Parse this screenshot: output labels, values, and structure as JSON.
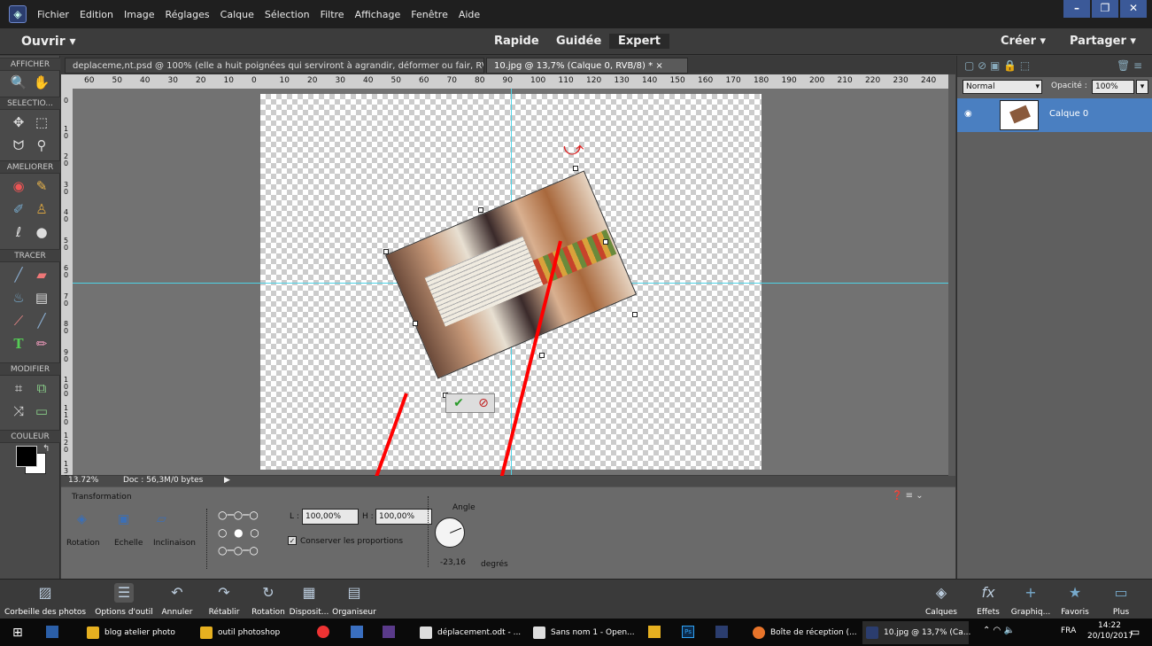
{
  "menubar": {
    "items": [
      "Fichier",
      "Edition",
      "Image",
      "Réglages",
      "Calque",
      "Sélection",
      "Filtre",
      "Affichage",
      "Fenêtre",
      "Aide"
    ]
  },
  "modebar": {
    "open_label": "Ouvrir",
    "modes": [
      "Rapide",
      "Guidée",
      "Expert"
    ],
    "active_mode": "Expert",
    "create_label": "Créer",
    "share_label": "Partager"
  },
  "toolbox": {
    "sections": [
      "AFFICHER",
      "SELECTIO...",
      "AMELIORER",
      "TRACER",
      "MODIFIER",
      "COULEUR"
    ]
  },
  "tabs": [
    {
      "label": "deplaceme,nt.psd @ 100% (elle a huit poignées qui serviront à agrandir, déformer ou fair, RVB/8) *",
      "close": "×"
    },
    {
      "label": "10.jpg @ 13,7% (Calque 0, RVB/8) *",
      "close": "×"
    }
  ],
  "ruler": {
    "h_ticks": [
      "60",
      "50",
      "40",
      "30",
      "20",
      "10",
      "0",
      "10",
      "20",
      "30",
      "40",
      "50",
      "60",
      "70",
      "80",
      "90",
      "100",
      "110",
      "120",
      "130",
      "140",
      "150",
      "160",
      "170",
      "180",
      "190",
      "200",
      "210",
      "220",
      "230",
      "240"
    ],
    "v_ticks": [
      "0",
      "1 0",
      "2 0",
      "3 0",
      "4 0",
      "5 0",
      "6 0",
      "7 0",
      "8 0",
      "9 0",
      "1 0 0",
      "1 1 0",
      "1 2 0",
      "1 3 0"
    ]
  },
  "status": {
    "zoom": "13.72%",
    "doc": "Doc : 56,3M/0 bytes"
  },
  "options": {
    "title": "Transformation",
    "buttons": [
      "Rotation",
      "Echelle",
      "Inclinaison"
    ],
    "width_label": "L :",
    "width_value": "100,00%",
    "height_label": "H :",
    "height_value": "100,00%",
    "keep_proportions": "Conserver les proportions",
    "angle_label": "Angle",
    "angle_value": "-23,16",
    "degrees_label": "degrés"
  },
  "layers": {
    "blend_mode": "Normal",
    "opacity_label": "Opacité :",
    "opacity_value": "100%",
    "layer_name": "Calque 0"
  },
  "bottombar": {
    "left": [
      "Corbeille des photos",
      "Options d'outil",
      "Annuler",
      "Rétablir",
      "Rotation",
      "Disposit...",
      "Organiseur"
    ],
    "right": [
      "Calques",
      "Effets",
      "Graphiq...",
      "Favoris",
      "Plus"
    ]
  },
  "taskbar": {
    "items": [
      "blog atelier photo",
      "outil photoshop",
      "déplacement.odt - ...",
      "Sans nom 1 - Open...",
      "Boîte de réception (...",
      "10.jpg @ 13,7% (Ca..."
    ],
    "lang": "FRA",
    "time": "14:22",
    "date": "20/10/2017"
  },
  "colors": {
    "accent": "#4a7fc1",
    "annotation": "#ff0000",
    "guide": "#4fd3e6"
  }
}
